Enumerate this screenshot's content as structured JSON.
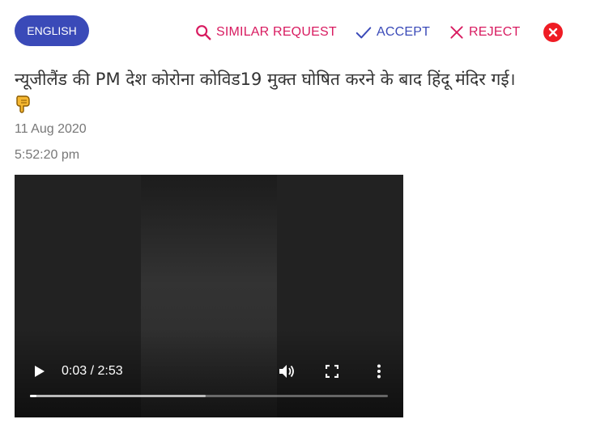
{
  "language": {
    "label": "ENGLISH"
  },
  "actions": {
    "similar_request": "SIMILAR REQUEST",
    "accept": "ACCEPT",
    "reject": "REJECT"
  },
  "colors": {
    "primary": "#3a4ab8",
    "danger": "#d81b60",
    "close": "#ef1c24"
  },
  "post": {
    "headline": "न्यूजीलैंड की PM देश कोरोना कोविड19 मुक्त घोषित करने के बाद हिंदू मंदिर गई।",
    "emoji": "backhand-index-pointing-down-icon",
    "date": "11 Aug 2020",
    "time": "5:52:20 pm"
  },
  "video": {
    "time_display": "0:03 / 2:53",
    "progress_fraction": 0.017,
    "buffered_fraction": 0.49
  }
}
